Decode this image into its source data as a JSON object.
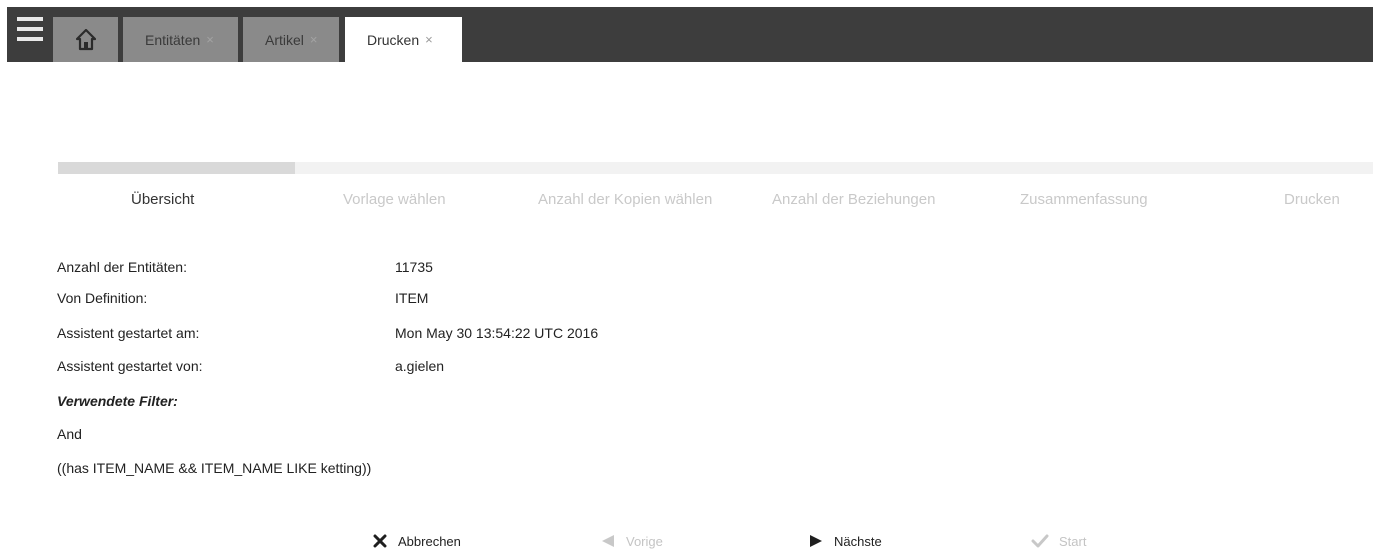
{
  "tabs": [
    {
      "label": "",
      "icon": "home-icon",
      "active": false
    },
    {
      "label": "Entitäten",
      "close": "×",
      "active": false
    },
    {
      "label": "Artikel",
      "close": "×",
      "active": false
    },
    {
      "label": "Drucken",
      "close": "×",
      "active": true
    }
  ],
  "wizard": {
    "progress": 0.18,
    "steps": [
      {
        "label": "Übersicht",
        "active": true
      },
      {
        "label": "Vorlage wählen",
        "active": false
      },
      {
        "label": "Anzahl der Kopien wählen",
        "active": false
      },
      {
        "label": "Anzahl der Beziehungen",
        "active": false
      },
      {
        "label": "Zusammenfassung",
        "active": false
      },
      {
        "label": "Drucken",
        "active": false
      }
    ]
  },
  "summary": {
    "rows": [
      {
        "label": "Anzahl der Entitäten:",
        "value": "11735"
      },
      {
        "label": "Von Definition:",
        "value": "ITEM"
      },
      {
        "label": "Assistent gestartet am:",
        "value": "Mon May 30 13:54:22 UTC 2016"
      },
      {
        "label": "Assistent gestartet von:",
        "value": "a.gielen"
      }
    ],
    "filter_heading": "Verwendete Filter:",
    "filter_operator": "And",
    "filter_expression": "((has ITEM_NAME && ITEM_NAME LIKE ketting))"
  },
  "actions": {
    "cancel": {
      "label": "Abbrechen",
      "icon": "close-icon",
      "enabled": true
    },
    "previous": {
      "label": "Vorige",
      "icon": "arrow-left-icon",
      "enabled": false
    },
    "next": {
      "label": "Nächste",
      "icon": "arrow-right-icon",
      "enabled": true
    },
    "start": {
      "label": "Start",
      "icon": "checkmark-icon",
      "enabled": false
    }
  },
  "colors": {
    "topbar": "#3d3d3d",
    "inactive_tab": "#8a8a8a",
    "disabled_text": "#c9c9c9"
  }
}
